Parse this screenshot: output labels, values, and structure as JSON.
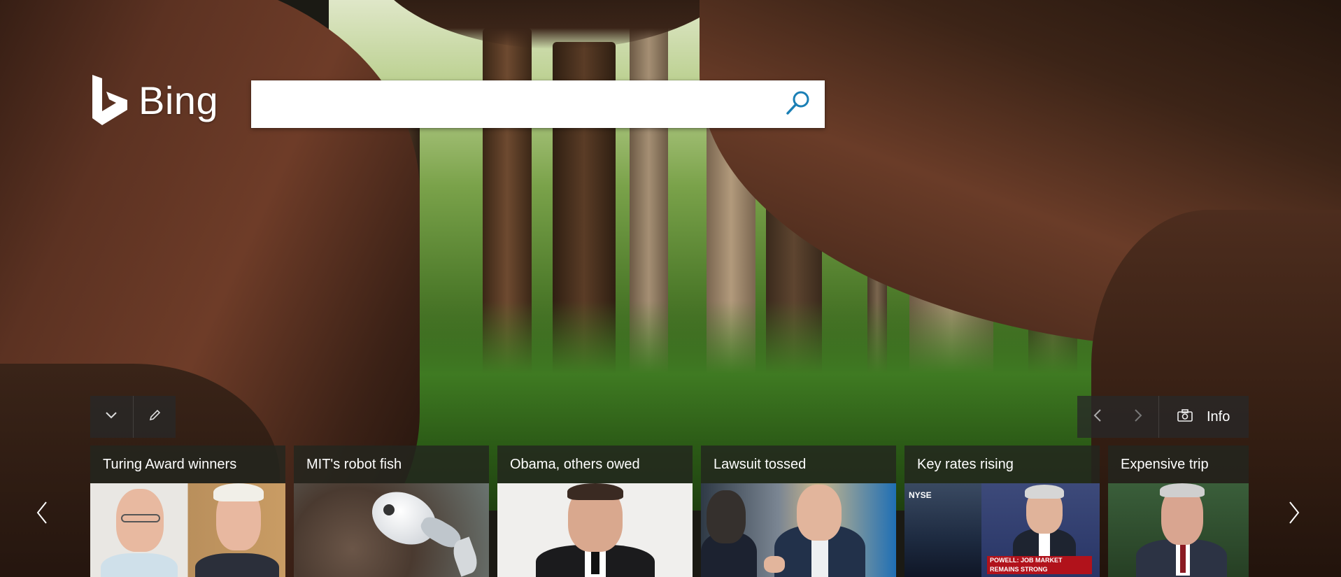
{
  "brand": {
    "name": "Bing",
    "logo_icon": "bing-logo-icon"
  },
  "search": {
    "placeholder": "",
    "value": "",
    "icon": "search-icon"
  },
  "controls_left": {
    "collapse_icon": "chevron-down-icon",
    "edit_icon": "pencil-icon"
  },
  "controls_right": {
    "prev_icon": "chevron-left-icon",
    "next_icon": "chevron-right-icon",
    "camera_icon": "camera-icon",
    "info_label": "Info"
  },
  "carousel": {
    "prev_icon": "chevron-left-icon",
    "next_icon": "chevron-right-icon",
    "cards": [
      {
        "title": "Turing Award winners"
      },
      {
        "title": "MIT's robot fish"
      },
      {
        "title": "Obama, others owed"
      },
      {
        "title": "Lawsuit tossed"
      },
      {
        "title": "Key rates rising",
        "image_caption": "POWELL: JOB MARKET REMAINS STRONG",
        "image_tag": "NYSE"
      },
      {
        "title": "Expensive trip"
      }
    ]
  },
  "colors": {
    "search_icon": "#1a7fb5",
    "panel_bg": "#282828",
    "text": "#ffffff"
  }
}
